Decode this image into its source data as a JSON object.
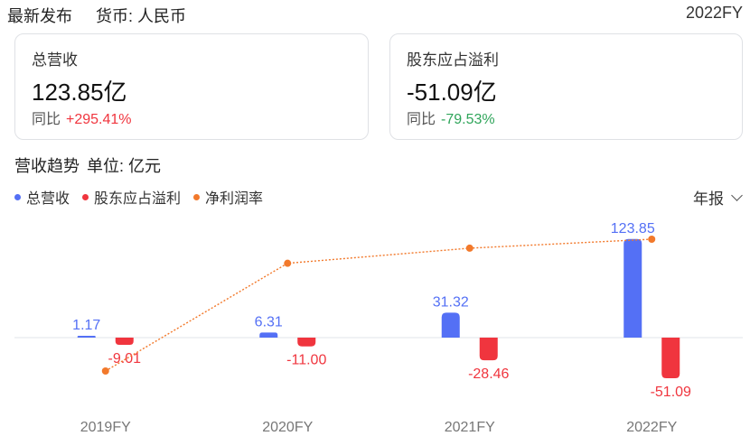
{
  "header": {
    "title": "最新发布",
    "currency": "货币: 人民币",
    "period": "2022FY"
  },
  "cards": [
    {
      "label": "总营收",
      "value": "123.85亿",
      "yoy_label": "同比",
      "yoy_value": "+295.41%",
      "yoy_color": "#f0353e"
    },
    {
      "label": "股东应占溢利",
      "value": "-51.09亿",
      "yoy_label": "同比",
      "yoy_value": "-79.53%",
      "yoy_color": "#2fa55a"
    }
  ],
  "section": {
    "title": "营收趋势",
    "unit": "单位: 亿元"
  },
  "period_selector": {
    "label": "年报"
  },
  "colors": {
    "revenue": "#5470f5",
    "profit": "#f0353e",
    "margin": "#f2792b"
  },
  "chart_data": {
    "type": "bar",
    "categories": [
      "2019FY",
      "2020FY",
      "2021FY",
      "2022FY"
    ],
    "series": [
      {
        "name": "总营收",
        "values": [
          1.17,
          6.31,
          31.32,
          123.85
        ],
        "labels": [
          "1.17",
          "6.31",
          "31.32",
          "123.85"
        ]
      },
      {
        "name": "股东应占溢利",
        "values": [
          -9.01,
          -11.0,
          -28.46,
          -51.09
        ],
        "labels": [
          "-9.01",
          "-11.00",
          "-28.46",
          "-51.09"
        ]
      },
      {
        "name": "净利润率",
        "type": "line",
        "values": [
          -770.1,
          -174.3,
          -90.9,
          -41.3
        ]
      }
    ],
    "grid": false,
    "legend": "top-left"
  }
}
